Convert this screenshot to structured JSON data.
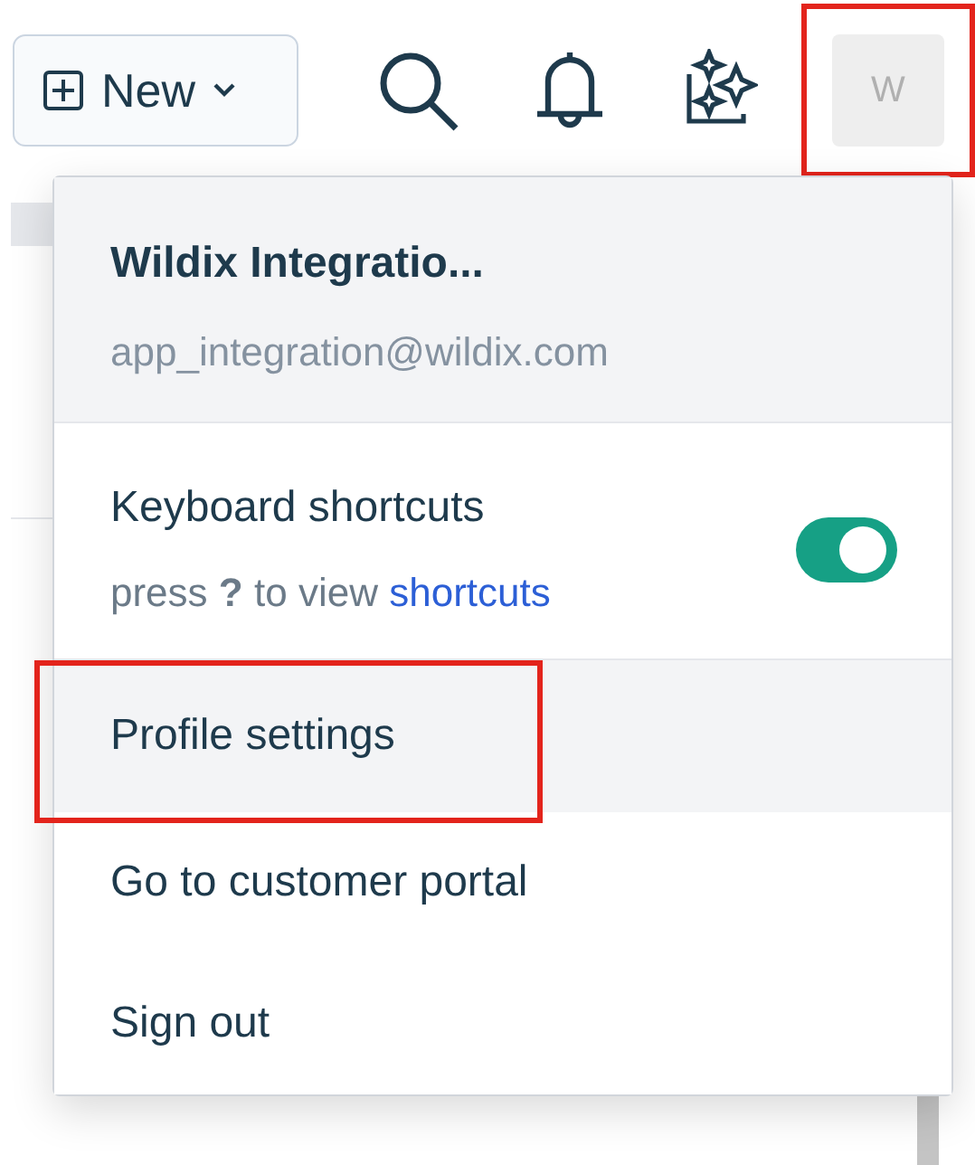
{
  "toolbar": {
    "new_button": {
      "label": "New"
    },
    "icons": [
      {
        "kind": "search"
      },
      {
        "kind": "bell"
      },
      {
        "kind": "sparkle"
      }
    ],
    "avatar": {
      "initial": "W",
      "annotated": true
    }
  },
  "account_menu": {
    "name": "Wildix Integratio...",
    "email": "app_integration@wildix.com",
    "shortcuts": {
      "label": "Keyboard shortcuts",
      "hint": "press **?** to view",
      "link": "shortcuts",
      "on": true
    },
    "items": [
      {
        "label": "Profile settings",
        "highlighted": true,
        "annotated": true
      },
      {
        "label": "Go to customer portal",
        "highlighted": false,
        "annotated": false
      },
      {
        "label": "Sign out",
        "highlighted": false,
        "annotated": false
      }
    ]
  }
}
